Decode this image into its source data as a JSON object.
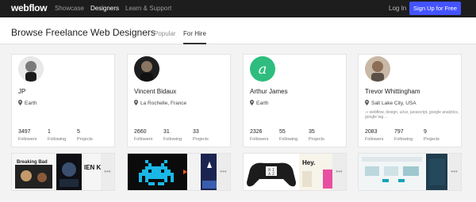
{
  "nav": {
    "logo": "webflow",
    "links": [
      "Showcase",
      "Designers",
      "Learn & Support"
    ],
    "login": "Log In",
    "signup": "Sign Up for Free"
  },
  "subheader": {
    "title": "Browse Freelance Web Designers",
    "tabs": [
      "Popular",
      "For Hire"
    ]
  },
  "stat_labels": [
    "Followers",
    "Following",
    "Projects"
  ],
  "designers": [
    {
      "name": "JP",
      "location": "Earth",
      "followers": "3497",
      "following": "1",
      "projects": "5",
      "tags": ""
    },
    {
      "name": "Vincent Bidaux",
      "location": "La Rochelle, France",
      "followers": "2660",
      "following": "31",
      "projects": "33",
      "tags": ""
    },
    {
      "name": "Arthur James",
      "location": "Earth",
      "followers": "2326",
      "following": "55",
      "projects": "35",
      "tags": ""
    },
    {
      "name": "Trevor Whittingham",
      "location": "Salt Lake City, USA",
      "followers": "2083",
      "following": "797",
      "projects": "9",
      "tags": "webflow, design, ui/ux, javascript, google analytics, google tag ..."
    }
  ],
  "thumbnails": {
    "breaking_bad": "Breaking Bad",
    "hey": "Hey.",
    "ienkal": "IEN KAL",
    "more": "•••"
  },
  "colors": {
    "topbar": "#1d1d1d",
    "accent": "#4353ff",
    "arthur_avatar": "#2ebd7e"
  },
  "icons": {
    "location": "map-pin-icon",
    "more": "ellipsis-icon"
  }
}
